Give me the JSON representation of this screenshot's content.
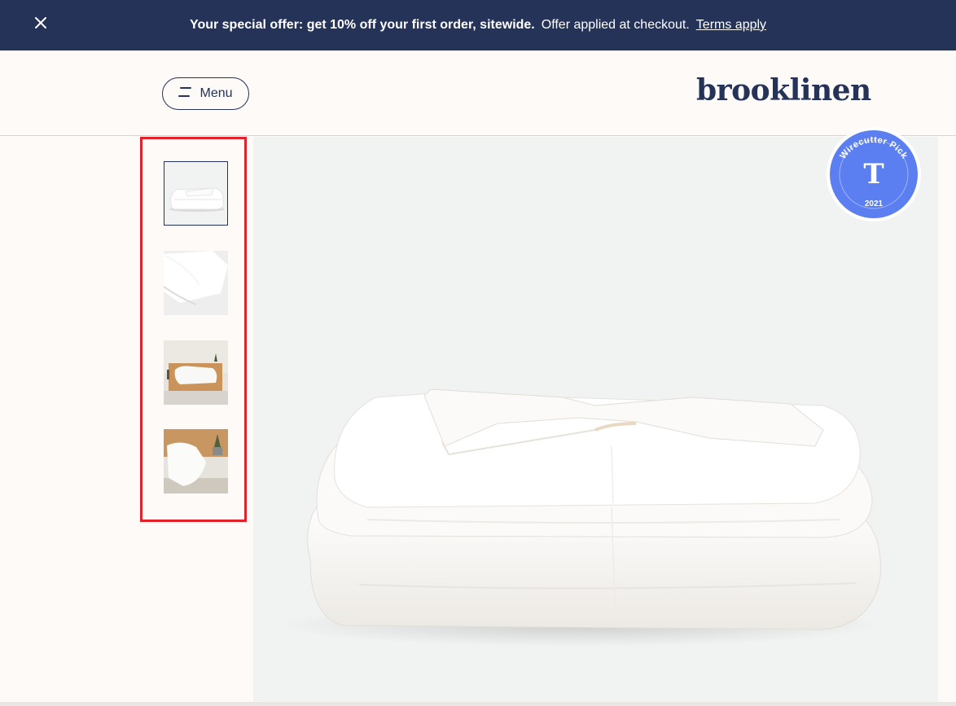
{
  "announcement": {
    "close_icon": "close-icon",
    "offer_text": "Your special offer: get 10% off your first order, sitewide.",
    "applied_text": "Offer applied at checkout.",
    "terms_link": "Terms apply",
    "colors": {
      "background": "#253359",
      "text": "#ffffff"
    }
  },
  "header": {
    "menu_label": "Menu",
    "menu_icon": "hamburger-icon",
    "logo_text": "brooklinen",
    "colors": {
      "brand": "#253359",
      "background": "#fdfaf7"
    }
  },
  "gallery": {
    "thumbnails": [
      {
        "name": "folded-comforter-thumbnail",
        "active": true
      },
      {
        "name": "comforter-corner-thumbnail",
        "active": false
      },
      {
        "name": "bedroom-comforter-thumbnail",
        "active": false
      },
      {
        "name": "bedroom-comforter-detail-thumbnail",
        "active": false
      }
    ],
    "highlight_color": "#e3212b",
    "main_image": "folded-white-comforter-image"
  },
  "badge": {
    "top_text": "Wirecutter Pick",
    "year": "2021",
    "icon": "nyt-logo-icon",
    "color": "#5b7ff0"
  }
}
